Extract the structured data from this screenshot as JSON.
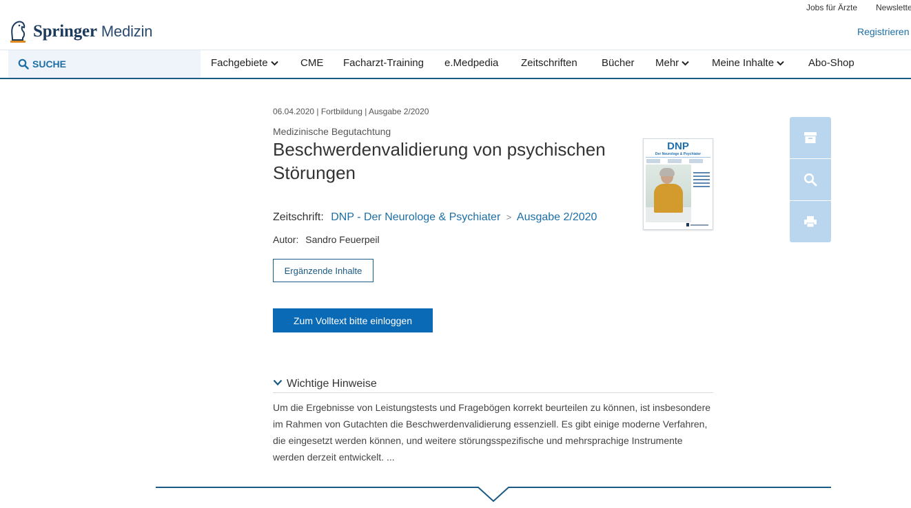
{
  "utility": {
    "jobs": "Jobs für Ärzte",
    "newsletter": "Newslette"
  },
  "brand": {
    "bold": "Springer",
    "light": "Medizin"
  },
  "header": {
    "register": "Registrieren"
  },
  "nav": {
    "search_label": "SUCHE",
    "items": [
      {
        "label": "Fachgebiete",
        "has_dropdown": true
      },
      {
        "label": "CME",
        "has_dropdown": false
      },
      {
        "label": "Facharzt-Training",
        "has_dropdown": false
      },
      {
        "label": "e.Medpedia",
        "has_dropdown": false
      },
      {
        "label": "Zeitschriften",
        "has_dropdown": false
      },
      {
        "label": "Bücher",
        "has_dropdown": false
      },
      {
        "label": "Mehr",
        "has_dropdown": true
      },
      {
        "label": "Meine Inhalte",
        "has_dropdown": true
      },
      {
        "label": "Abo-Shop",
        "has_dropdown": false
      }
    ]
  },
  "article": {
    "meta": "06.04.2020 | Fortbildung | Ausgabe 2/2020",
    "subject": "Medizinische Begutachtung",
    "title": "Beschwerdenvalidierung von psychischen Störungen",
    "journal_label": "Zeitschrift:",
    "journal_name": "DNP - Der Neurologe & Psychiater",
    "journal_sep": ">",
    "issue": "Ausgabe 2/2020",
    "author_label": "Autor:",
    "author": "Sandro Feuerpeil",
    "supplementary_button": "Ergänzende Inhalte",
    "login_button": "Zum Volltext bitte einloggen"
  },
  "cover": {
    "title": "DNP",
    "subtitle": "Der Neurologe & Psychiater"
  },
  "tools": [
    "archive-icon",
    "search-icon",
    "print-icon"
  ],
  "hints": {
    "heading": "Wichtige Hinweise",
    "text": "Um die Ergebnisse von Leistungstests und Fragebögen korrekt beurteilen zu können, ist insbesondere im Rahmen von Gutachten die Beschwerdenvalidierung essenziell. Es gibt einige moderne Verfahren, die eingesetzt werden können, und weitere störungsspezifische und mehrsprachige Instrumente werden derzeit entwickelt. ..."
  },
  "colors": {
    "brand_blue": "#1b5a84",
    "link_blue": "#1c6ea4",
    "primary_button": "#0a6ab5",
    "tool_bg": "#b9d6ee"
  }
}
